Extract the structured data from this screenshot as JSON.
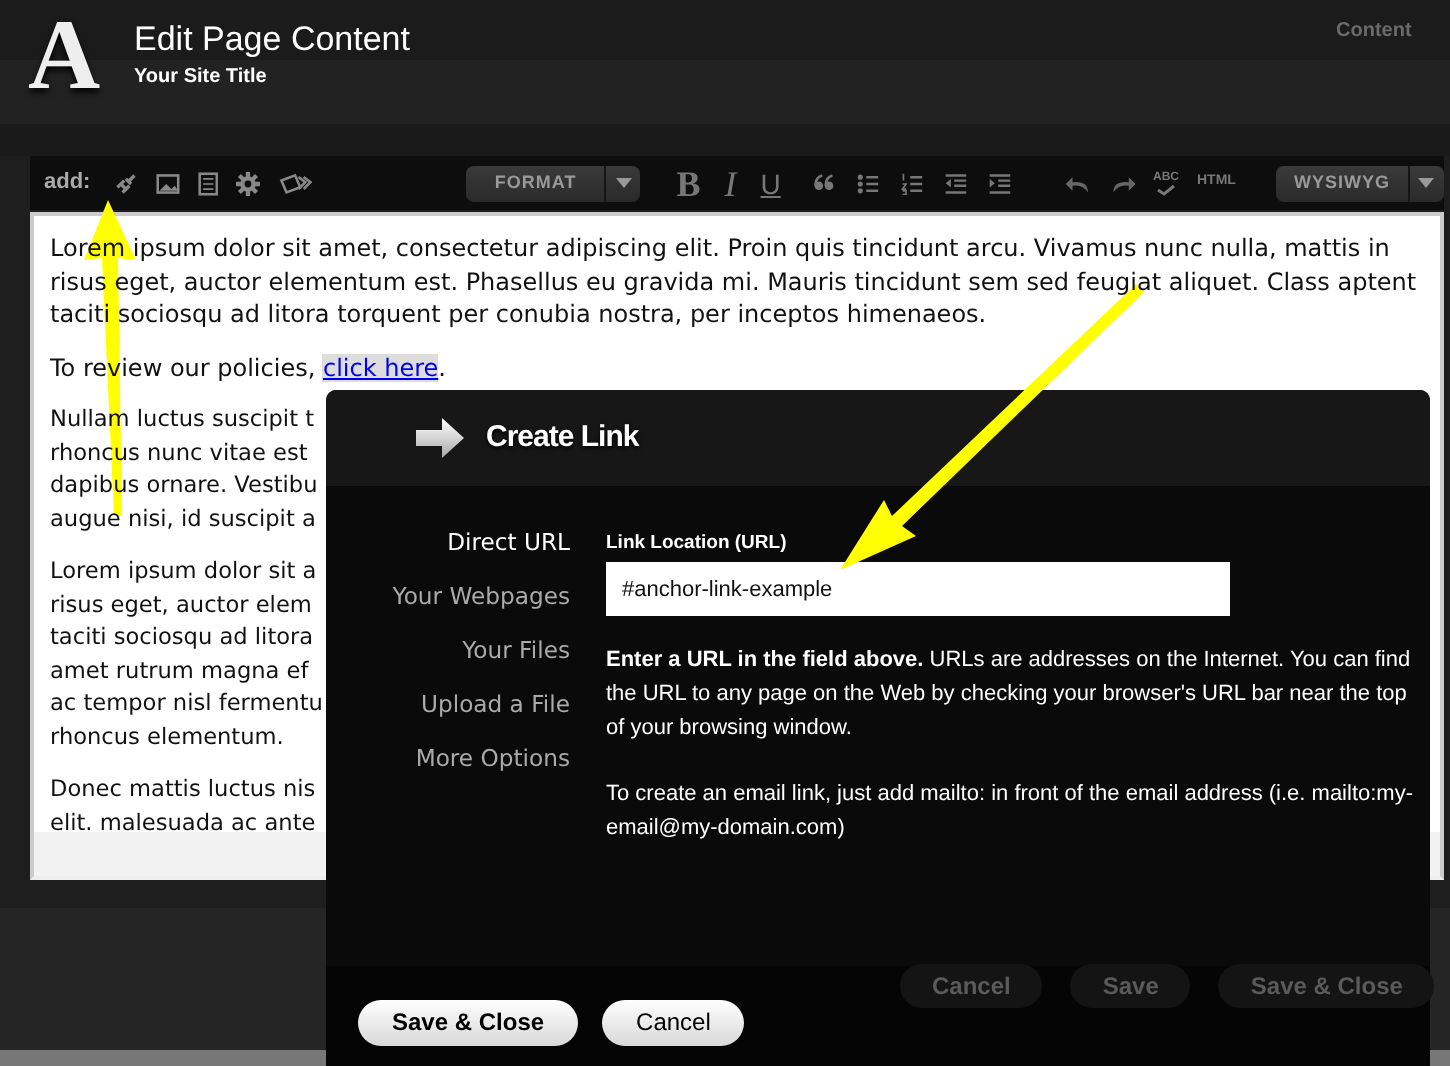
{
  "header": {
    "logo": "A",
    "title": "Edit Page Content",
    "subtitle": "Your Site Title",
    "corner_label": "Content"
  },
  "toolbar": {
    "add_label": "add:",
    "style_buttons": [
      "B",
      "I",
      "U"
    ],
    "format_dropdown": "FORMAT",
    "spellcheck_label": "ABC",
    "html_label": "HTML",
    "mode_dropdown": "WYSIWYG"
  },
  "editor": {
    "paragraphs": [
      {
        "kind": "text",
        "text": "Lorem ipsum dolor sit amet, consectetur adipiscing elit. Proin quis tincidunt arcu. Vivamus nunc nulla, mattis in risus eget, auctor elementum est. Phasellus eu gravida mi. Mauris tincidunt sem sed feugiat aliquet. Class aptent taciti sociosqu ad litora torquent per conubia nostra, per inceptos himenaeos."
      },
      {
        "kind": "link",
        "before": "To review our policies, ",
        "link": "click here",
        "after": "."
      }
    ],
    "covered_paragraphs": [
      [
        "Nullam luctus suscipit t",
        "rhoncus nunc vitae est",
        "dapibus ornare. Vestibu",
        "augue nisi, id suscipit a"
      ],
      [
        "Lorem ipsum dolor sit a",
        "risus eget, auctor elem",
        "taciti sociosqu ad litora",
        "amet rutrum magna ef",
        "ac tempor nisl fermentu",
        "rhoncus elementum."
      ],
      [
        "Donec mattis luctus nis",
        "elit. malesuada ac ante"
      ]
    ]
  },
  "page_buttons": [
    "Cancel",
    "Save",
    "Save & Close"
  ],
  "dialog": {
    "title": "Create Link",
    "nav": [
      {
        "label": "Direct URL",
        "selected": true
      },
      {
        "label": "Your Webpages",
        "selected": false
      },
      {
        "label": "Your Files",
        "selected": false
      },
      {
        "label": "Upload a File",
        "selected": false
      },
      {
        "label": "More Options",
        "selected": false
      }
    ],
    "field_label": "Link Location (URL)",
    "field_value": "#anchor-link-example",
    "help": "**Enter a URL in the field above.** URLs are addresses on the Internet. You can find the URL to any page on the Web by checking your browser's URL bar near the top of your browsing window.",
    "email_note": "To create an email link, just add mailto: in front of the email address (i.e. mailto:my-email@my-domain.com)",
    "buttons": [
      "Save & Close",
      "Cancel"
    ]
  }
}
